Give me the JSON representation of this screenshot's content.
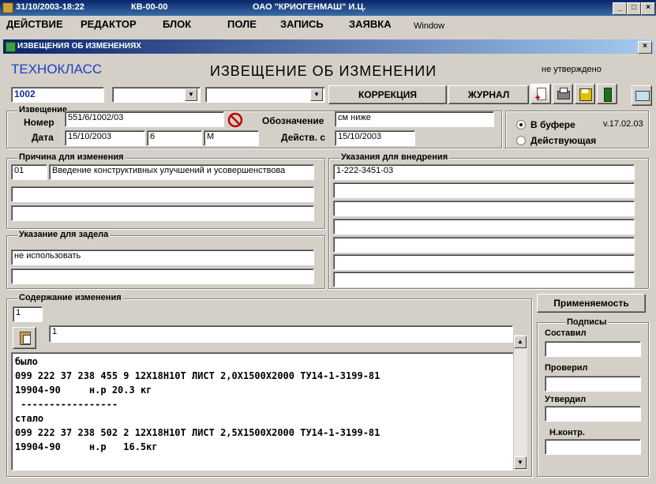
{
  "titlebar": {
    "timestamp": "31/10/2003-18:22",
    "code": "КВ-00-00",
    "company": "ОАО \"КРИОГЕНМАШ\" И.Ц."
  },
  "menu": {
    "items": [
      "ДЕЙСТВИЕ",
      "РЕДАКТОР",
      "БЛОК",
      "ПОЛЕ",
      "ЗАПИСЬ",
      "ЗАЯВКА"
    ],
    "window": "Window"
  },
  "child_window": {
    "title": "ИЗВЕЩЕНИЯ ОБ ИЗМЕНЕНИЯХ"
  },
  "header": {
    "brand": "ТЕХНОКЛАСС",
    "title": "ИЗВЕЩЕНИЕ ОБ ИЗМЕНЕНИИ",
    "status": "не утверждено"
  },
  "toolbar": {
    "code_value": "1002",
    "correction_label": "КОРРЕКЦИЯ",
    "journal_label": "ЖУРНАЛ"
  },
  "notice": {
    "group_label": "Извещение",
    "number_label": "Номер",
    "number_value": "551/6/1002/03",
    "date_label": "Дата",
    "date_value": "15/10/2003",
    "date_extra1": "6",
    "date_extra2": "М",
    "designation_label": "Обозначение",
    "designation_value": "см ниже",
    "effective_label": "Действ. с",
    "effective_value": "15/10/2003"
  },
  "state": {
    "buffer_label": "В буфере",
    "version": "v.17.02.03",
    "active_label": "Действующая"
  },
  "reason": {
    "group_label": "Причина для изменения",
    "code": "01",
    "text": "Введение конструктивных улучшений и усовершенствова"
  },
  "implementation": {
    "group_label": "Указания для внедрения",
    "rows": [
      "1-222-3451-03",
      "",
      "",
      "",
      "",
      "",
      ""
    ]
  },
  "backlog": {
    "group_label": "Указание для задела",
    "value": "не использовать"
  },
  "content": {
    "group_label": "Содержание изменения",
    "page_no": "1",
    "line_no": "1",
    "lines": [
      "было",
      "099 222 37 238 455 9 12Х18Н10Т ЛИСТ 2,0Х1500Х2000 ТУ14-1-3199-81",
      "19904-90     н.р 20.3 кг",
      " -----------------",
      "стало",
      "099 222 37 238 502 2 12Х18Н10Т ЛИСТ 2,5Х1500Х2000 ТУ14-1-3199-81",
      "19904-90     н.р   16.5кг"
    ]
  },
  "applicability": {
    "label": "Применяемость"
  },
  "signatures": {
    "group_label": "Подписы",
    "composed": "Составил",
    "checked": "Проверил",
    "approved": "Утвердил",
    "norm_control": "Н.контр."
  }
}
